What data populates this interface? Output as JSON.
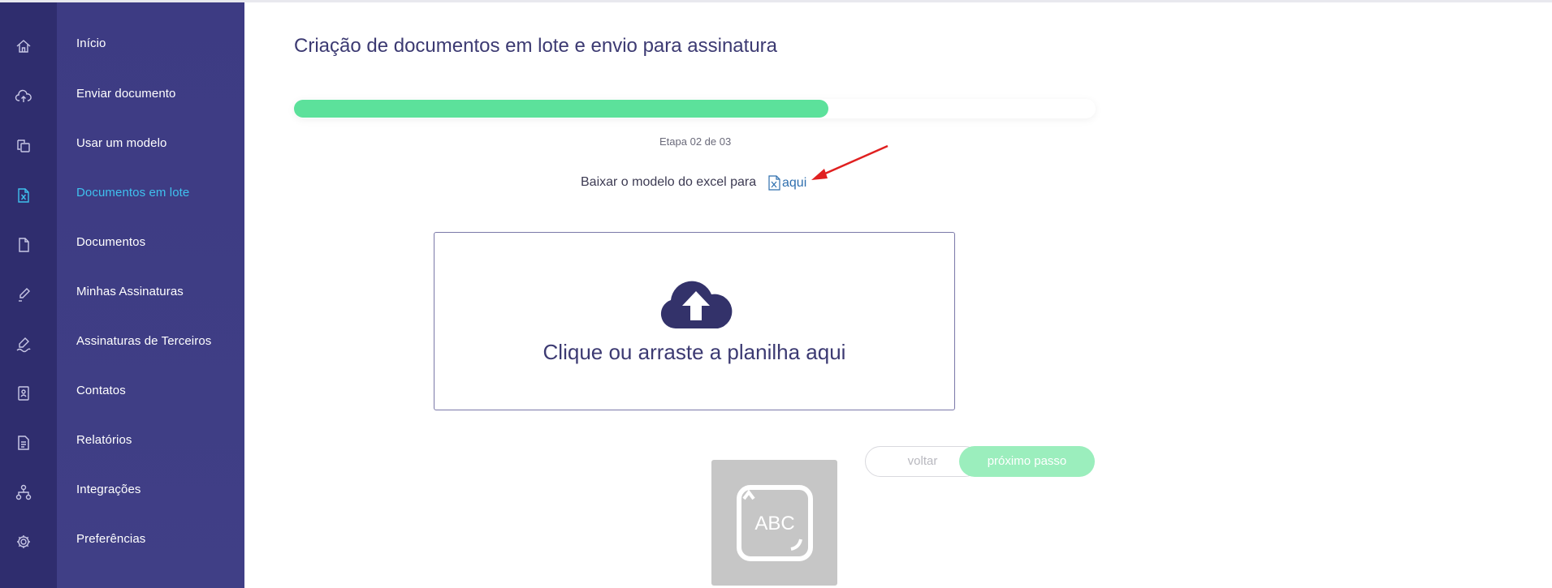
{
  "sidebar": {
    "items": [
      {
        "label": "Início",
        "icon": "home-icon"
      },
      {
        "label": "Enviar documento",
        "icon": "cloud-upload-icon"
      },
      {
        "label": "Usar um modelo",
        "icon": "template-icon"
      },
      {
        "label": "Documentos em lote",
        "icon": "excel-file-icon",
        "active": true
      },
      {
        "label": "Documentos",
        "icon": "document-icon"
      },
      {
        "label": "Minhas Assinaturas",
        "icon": "pen-icon"
      },
      {
        "label": "Assinaturas de Terceiros",
        "icon": "signature-icon"
      },
      {
        "label": "Contatos",
        "icon": "contacts-icon"
      },
      {
        "label": "Relatórios",
        "icon": "report-icon"
      },
      {
        "label": "Integrações",
        "icon": "integrations-icon"
      },
      {
        "label": "Preferências",
        "icon": "gear-icon"
      }
    ],
    "active_color": "#3fc1ee"
  },
  "main": {
    "title": "Criação de documentos em lote e envio para assinatura",
    "progress": {
      "fraction": 0.667,
      "color": "#5ce19b"
    },
    "step_label": "Etapa 02 de 03",
    "download_text": "Baixar o modelo do excel para",
    "download_link": "aqui",
    "dropzone_text": "Clique ou arraste a planilha aqui",
    "back_button": "voltar",
    "next_button": "próximo passo",
    "keyboard_tile_text": "ABC"
  }
}
